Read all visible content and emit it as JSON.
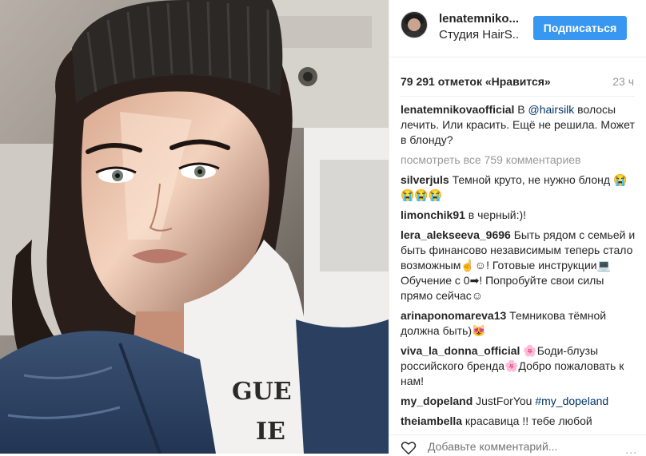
{
  "post": {
    "username": "lenatemniko...",
    "location": "Студия HairS..",
    "follow_label": "Подписаться",
    "likes": "79 291 отметок «Нравится»",
    "time": "23 ч"
  },
  "caption": {
    "user": "lenatemnikovaofficial",
    "before": " В ",
    "mention": "@hairsilk",
    "after": " волосы лечить. Или красить. Ещё не решила. Может в блонду?"
  },
  "more_comments": "посмотреть все 759 комментариев",
  "comments": [
    {
      "user": "silverjuls",
      "text": " Темной круто, не нужно блонд ",
      "emoji": "😭😭😭😭"
    },
    {
      "user": "limonchik91",
      "text": " в черный:)!"
    },
    {
      "user": "lera_alekseeva_9696",
      "text": " Быть рядом с семьей и быть финансово независимым теперь стало возможным☝☺! Готовые инструкции💻 Обучение с 0➡! Попробуйте свои силы прямо сейчас☺"
    },
    {
      "user": "arinaponomareva13",
      "text": " Темникова тёмной должна быть)😻"
    },
    {
      "user": "viva_la_donna_official",
      "text": " 🌸Боди-блузы российского бренда🌸Добро пожаловать к нам!"
    },
    {
      "user": "my_dopeland",
      "text": " JustForYou ",
      "tag": "#my_dopeland"
    },
    {
      "user": "theiambella",
      "text": " красавица !! тебе любой"
    }
  ],
  "footer": {
    "add_comment_placeholder": "Добавьте комментарий...",
    "more_icon": "..."
  },
  "icons": {
    "heart": "heart-outline-icon",
    "more": "more-options-icon"
  },
  "colors": {
    "follow_button": "#3897f0",
    "hashtag": "#003569",
    "muted": "#999999"
  }
}
